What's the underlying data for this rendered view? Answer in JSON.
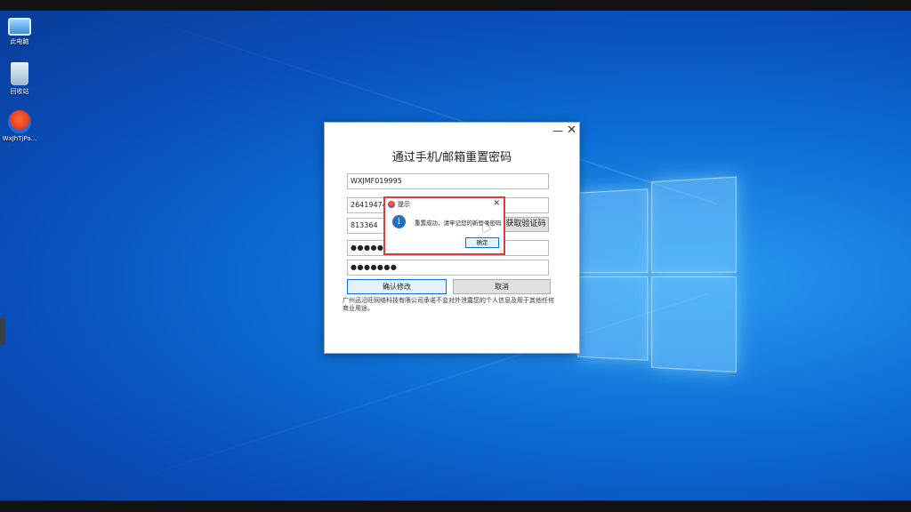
{
  "desktop": {
    "icons": [
      {
        "label": "此电脑",
        "icon": "computer-icon"
      },
      {
        "label": "回收站",
        "icon": "recycle-bin-icon"
      },
      {
        "label": "WxJhTjPa...",
        "icon": "app-shortcut-icon"
      }
    ]
  },
  "window": {
    "title": "通过手机/邮箱重置密码",
    "minimize_label": "—",
    "close_label": "✕",
    "account_value": "WXJMF019995",
    "phone_value": "264194742",
    "code_value": "813364",
    "get_code_label": "获取验证码",
    "password_mask": "●●●●●●●",
    "confirm_password_mask": "●●●●●●●",
    "confirm_label": "确认修改",
    "cancel_label": "取消",
    "notice": "广州迅沿旺网络科技有限公司承诺不会对外泄露您的个人信息及用于其他任何商业用途。"
  },
  "dialog": {
    "title": "提示",
    "close_label": "✕",
    "info_glyph": "i",
    "message": "重置成功，请牢记您的新登录密码",
    "ok_label": "确定"
  },
  "colors": {
    "highlight_border": "#e23b3b",
    "accent": "#0078d7",
    "info_icon": "#1e6fc8"
  }
}
